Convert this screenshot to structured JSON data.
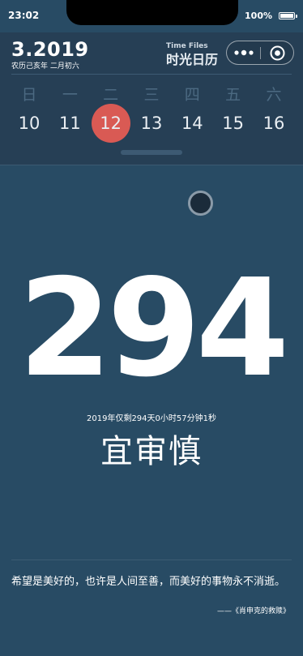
{
  "status_bar": {
    "time": "23:02",
    "battery_percent": "100%"
  },
  "header": {
    "date": "3.2019",
    "lunar_date": "农历己亥年 二月初六",
    "brand_en": "Time Files",
    "brand_cn": "时光日历"
  },
  "calendar": {
    "weekdays": [
      "日",
      "一",
      "二",
      "三",
      "四",
      "五",
      "六"
    ],
    "days": [
      "10",
      "11",
      "12",
      "13",
      "14",
      "15",
      "16"
    ],
    "selected_day": "12"
  },
  "main": {
    "days_number": "294",
    "countdown": "2019年仅剩294天0小时57分钟1秒",
    "fortune": "宜审慎"
  },
  "quote": {
    "text": "希望是美好的，也许是人间至善，而美好的事物永不消逝。",
    "source": "——《肖申克的救赎》"
  },
  "colors": {
    "background": "#284b64",
    "header_background": "#263f55",
    "selected_day_accent": "#d95a54"
  }
}
